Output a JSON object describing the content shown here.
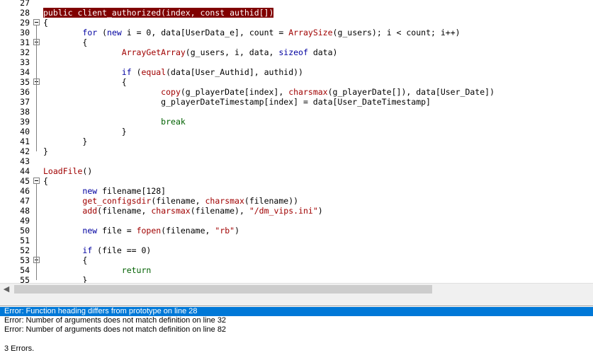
{
  "editor": {
    "lines": [
      {
        "n": "27",
        "code": ""
      },
      {
        "n": "28",
        "code": "public client_authorized(index, const authid[])"
      },
      {
        "n": "29",
        "code": "{"
      },
      {
        "n": "30",
        "code": "\tfor (new i = 0, data[UserData_e], count = ArraySize(g_users); i < count; i++)"
      },
      {
        "n": "31",
        "code": "\t{"
      },
      {
        "n": "32",
        "code": "\t\tArrayGetArray(g_users, i, data, sizeof data)"
      },
      {
        "n": "33",
        "code": ""
      },
      {
        "n": "34",
        "code": "\t\tif (equal(data[User_Authid], authid))"
      },
      {
        "n": "35",
        "code": "\t\t{"
      },
      {
        "n": "36",
        "code": "\t\t\tcopy(g_playerDate[index], charsmax(g_playerDate[]), data[User_Date])"
      },
      {
        "n": "37",
        "code": "\t\t\tg_playerDateTimestamp[index] = data[User_DateTimestamp]"
      },
      {
        "n": "38",
        "code": ""
      },
      {
        "n": "39",
        "code": "\t\t\tbreak"
      },
      {
        "n": "40",
        "code": "\t\t}"
      },
      {
        "n": "41",
        "code": "\t}"
      },
      {
        "n": "42",
        "code": "}"
      },
      {
        "n": "43",
        "code": ""
      },
      {
        "n": "44",
        "code": "LoadFile()"
      },
      {
        "n": "45",
        "code": "{"
      },
      {
        "n": "46",
        "code": "\tnew filename[128]"
      },
      {
        "n": "47",
        "code": "\tget_configsdir(filename, charsmax(filename))"
      },
      {
        "n": "48",
        "code": "\tadd(filename, charsmax(filename), \"/dm_vips.ini\")"
      },
      {
        "n": "49",
        "code": ""
      },
      {
        "n": "50",
        "code": "\tnew file = fopen(filename, \"rb\")"
      },
      {
        "n": "51",
        "code": ""
      },
      {
        "n": "52",
        "code": "\tif (file == 0)"
      },
      {
        "n": "53",
        "code": "\t{"
      },
      {
        "n": "54",
        "code": "\t\treturn"
      },
      {
        "n": "55",
        "code": "\t}"
      }
    ],
    "highlighted_line": "28",
    "fold_lines": [
      "29",
      "31",
      "35",
      "45",
      "53"
    ]
  },
  "output": {
    "messages": [
      "Error: Function heading differs from prototype on line 28",
      "Error: Number of arguments does not match definition on line 32",
      "Error: Number of arguments does not match definition on line 82"
    ],
    "selected_index": 0,
    "summary": "3 Errors."
  },
  "colors": {
    "highlight": "#800000",
    "selection": "#0078d7",
    "keyword": "#0000a0",
    "function": "#a00000",
    "string": "#a00000"
  }
}
